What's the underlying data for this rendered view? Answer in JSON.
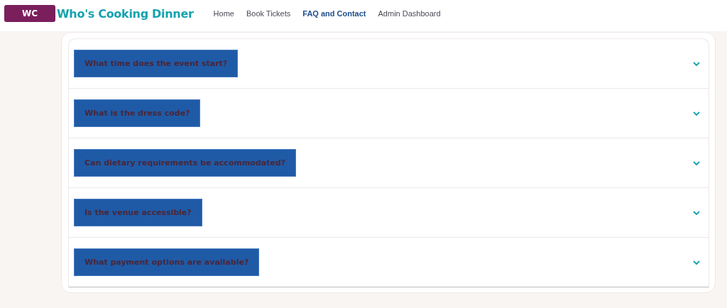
{
  "header": {
    "logo": "WC",
    "title": "Who's Cooking Dinner"
  },
  "nav": [
    {
      "label": "Home",
      "selected": false
    },
    {
      "label": "Book Tickets",
      "selected": false
    },
    {
      "label": "FAQ and Contact",
      "selected": true
    },
    {
      "label": "Admin Dashboard",
      "selected": false
    }
  ],
  "faq": [
    {
      "question": "What time does the event start?",
      "expanded": false
    },
    {
      "question": "What is the dress code?",
      "expanded": false
    },
    {
      "question": "Can dietary requirements be accommodated?",
      "expanded": false
    },
    {
      "question": "Is the venue accessible?",
      "expanded": false
    },
    {
      "question": "What payment options are available?",
      "expanded": false
    }
  ]
}
